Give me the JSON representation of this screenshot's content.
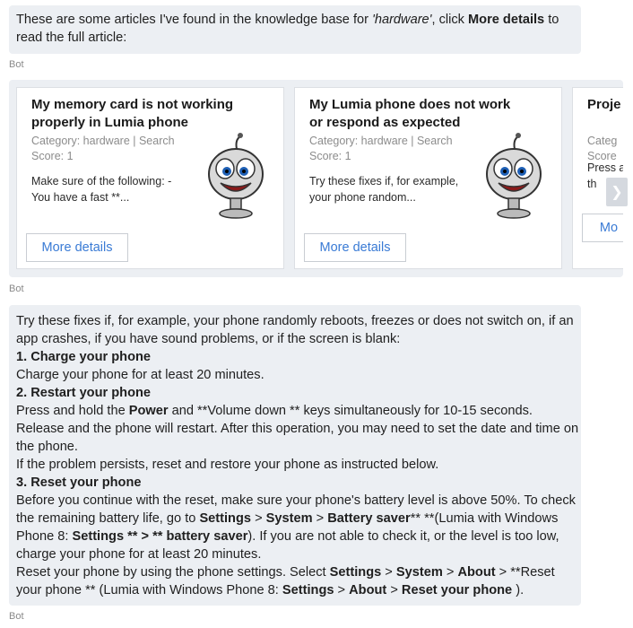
{
  "intro": {
    "text_before": "These are some articles I've found in the knowledge base for ",
    "query": "'hardware'",
    "text_middle": ", click ",
    "more_label": "More details",
    "text_after": " to read the full article:"
  },
  "bot_label": "Bot",
  "cards": [
    {
      "title": "My memory card is not working properly in Lumia phone",
      "category": "Category: hardware | Search",
      "score": "Score: 1",
      "snippet": "Make sure of the following: - You have a fast **...",
      "button": "More details",
      "image": "robot-avatar-icon"
    },
    {
      "title": "My Lumia phone does not work or respond as expected",
      "category": "Category: hardware | Search",
      "score": "Score: 1",
      "snippet": "Try these fixes if, for example, your phone random...",
      "button": "More details",
      "image": "robot-avatar-icon"
    },
    {
      "title": "Proje",
      "category": "Categ",
      "score": "Score",
      "snippet": "Press and th",
      "button": "Mo"
    }
  ],
  "article": {
    "intro": "Try these fixes if, for example, your phone randomly reboots, freezes or does not switch on, if an app crashes, if you have sound problems, or if the screen is blank:",
    "h1": "1. Charge your phone",
    "p1": "Charge your phone for at least 20 minutes.",
    "h2": "2. Restart your phone",
    "p2a": "Press and hold the ",
    "p2_power": "Power",
    "p2b": " and **Volume down ** keys simultaneously for 10-15 seconds. Release and the phone will restart. After this operation, you may need to set the date and time on the phone.",
    "p2c": "If the problem persists, reset and restore your phone as instructed below.",
    "h3": "3. Reset your phone",
    "p3a": "Before you continue with the reset, make sure your phone's battery level is above 50%. To check the remaining battery life, go to ",
    "p3_settings": "Settings",
    "p3_sep1": " > ",
    "p3_system": "System",
    "p3_sep2": " > ",
    "p3_battery": "Battery saver",
    "p3b": "** **(Lumia with Windows Phone 8: ",
    "p3_wp8": "Settings ** > ** battery saver",
    "p3c": "). If you are not able to check it, or the level is too low, charge your phone for at least 20 minutes.",
    "p4a": "Reset your phone by using the phone settings. Select ",
    "p4_settings": "Settings",
    "p4_sep1": " > ",
    "p4_system": "System",
    "p4_sep2": " > ",
    "p4_about": "About",
    "p4b": " > **Reset your phone ** (Lumia with Windows Phone 8: ",
    "p4_settings2": "Settings",
    "p4_sep3": " > ",
    "p4_about2": "About",
    "p4_sep4": " > ",
    "p4_reset": "Reset your phone",
    "p4c": " )."
  },
  "colors": {
    "bubble": "#eceff3",
    "link": "#3a7bd5",
    "meta": "#8c8c8c"
  }
}
